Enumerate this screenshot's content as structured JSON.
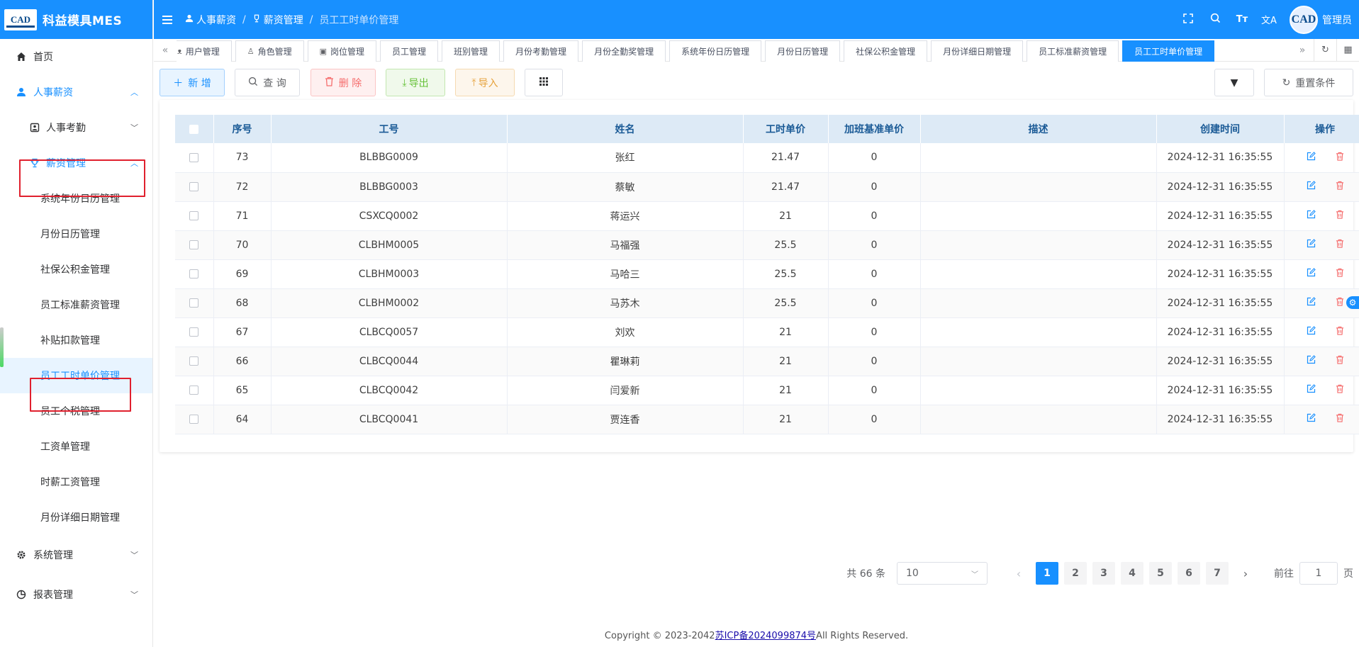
{
  "app": {
    "logo_text": "CAD",
    "title": "科益模具MES"
  },
  "sidebar": {
    "items": [
      {
        "label": "首页",
        "icon": "home-icon"
      },
      {
        "label": "人事薪资",
        "icon": "user-icon"
      },
      {
        "label": "人事考勤",
        "icon": "badge-icon"
      },
      {
        "label": "薪资管理",
        "icon": "trophy-icon"
      },
      {
        "label": "系统年份日历管理"
      },
      {
        "label": "月份日历管理"
      },
      {
        "label": "社保公积金管理"
      },
      {
        "label": "员工标准薪资管理"
      },
      {
        "label": "补贴扣款管理"
      },
      {
        "label": "员工工时单价管理"
      },
      {
        "label": "员工个税管理"
      },
      {
        "label": "工资单管理"
      },
      {
        "label": "时薪工资管理"
      },
      {
        "label": "月份详细日期管理"
      },
      {
        "label": "系统管理",
        "icon": "gear-icon"
      },
      {
        "label": "报表管理",
        "icon": "chart-icon"
      }
    ]
  },
  "header": {
    "breadcrumb": [
      "人事薪资",
      "薪资管理",
      "员工工时单价管理"
    ],
    "font_size_icon": "Tт",
    "translate_icon": "文A",
    "avatar_text": "CAD",
    "user_name": "管理员"
  },
  "tabs": [
    {
      "label": "用户管理",
      "icon": "user-icon"
    },
    {
      "label": "角色管理",
      "icon": "user-icon"
    },
    {
      "label": "岗位管理",
      "icon": "badge-icon"
    },
    {
      "label": "员工管理"
    },
    {
      "label": "班别管理"
    },
    {
      "label": "月份考勤管理"
    },
    {
      "label": "月份全勤奖管理"
    },
    {
      "label": "系统年份日历管理"
    },
    {
      "label": "月份日历管理"
    },
    {
      "label": "社保公积金管理"
    },
    {
      "label": "月份详细日期管理"
    },
    {
      "label": "员工标准薪资管理"
    },
    {
      "label": "员工工时单价管理",
      "active": true
    }
  ],
  "toolbar": {
    "add": "新 增",
    "query": "查 询",
    "delete": "删 除",
    "export": "导出",
    "import": "导入",
    "reset": "重置条件"
  },
  "table": {
    "columns": [
      "序号",
      "工号",
      "姓名",
      "工时单价",
      "加班基准单价",
      "描述",
      "创建时间",
      "操作"
    ],
    "rows": [
      {
        "seq": "73",
        "code": "BLBBG0009",
        "name": "张红",
        "rate": "21.47",
        "ot": "0",
        "desc": "",
        "time": "2024-12-31 16:35:55"
      },
      {
        "seq": "72",
        "code": "BLBBG0003",
        "name": "蔡敏",
        "rate": "21.47",
        "ot": "0",
        "desc": "",
        "time": "2024-12-31 16:35:55"
      },
      {
        "seq": "71",
        "code": "CSXCQ0002",
        "name": "蒋运兴",
        "rate": "21",
        "ot": "0",
        "desc": "",
        "time": "2024-12-31 16:35:55"
      },
      {
        "seq": "70",
        "code": "CLBHM0005",
        "name": "马福强",
        "rate": "25.5",
        "ot": "0",
        "desc": "",
        "time": "2024-12-31 16:35:55"
      },
      {
        "seq": "69",
        "code": "CLBHM0003",
        "name": "马哈三",
        "rate": "25.5",
        "ot": "0",
        "desc": "",
        "time": "2024-12-31 16:35:55"
      },
      {
        "seq": "68",
        "code": "CLBHM0002",
        "name": "马苏木",
        "rate": "25.5",
        "ot": "0",
        "desc": "",
        "time": "2024-12-31 16:35:55"
      },
      {
        "seq": "67",
        "code": "CLBCQ0057",
        "name": "刘欢",
        "rate": "21",
        "ot": "0",
        "desc": "",
        "time": "2024-12-31 16:35:55"
      },
      {
        "seq": "66",
        "code": "CLBCQ0044",
        "name": "瞿琳莉",
        "rate": "21",
        "ot": "0",
        "desc": "",
        "time": "2024-12-31 16:35:55"
      },
      {
        "seq": "65",
        "code": "CLBCQ0042",
        "name": "闫爱新",
        "rate": "21",
        "ot": "0",
        "desc": "",
        "time": "2024-12-31 16:35:55"
      },
      {
        "seq": "64",
        "code": "CLBCQ0041",
        "name": "贾连香",
        "rate": "21",
        "ot": "0",
        "desc": "",
        "time": "2024-12-31 16:35:55"
      }
    ]
  },
  "pagination": {
    "total": "共 66 条",
    "page_size": "10",
    "pages": [
      "1",
      "2",
      "3",
      "4",
      "5",
      "6",
      "7"
    ],
    "current": "1",
    "goto_label": "前往",
    "goto_value": "1",
    "page_suffix": "页"
  },
  "footer": {
    "prefix": "Copyright © 2023-2042",
    "icp": "苏ICP备2024099874号",
    "suffix": "All Rights Reserved."
  },
  "colors": {
    "primary": "#1890ff",
    "danger": "#f56c6c",
    "success": "#67c23a",
    "warning": "#e6a23c"
  }
}
